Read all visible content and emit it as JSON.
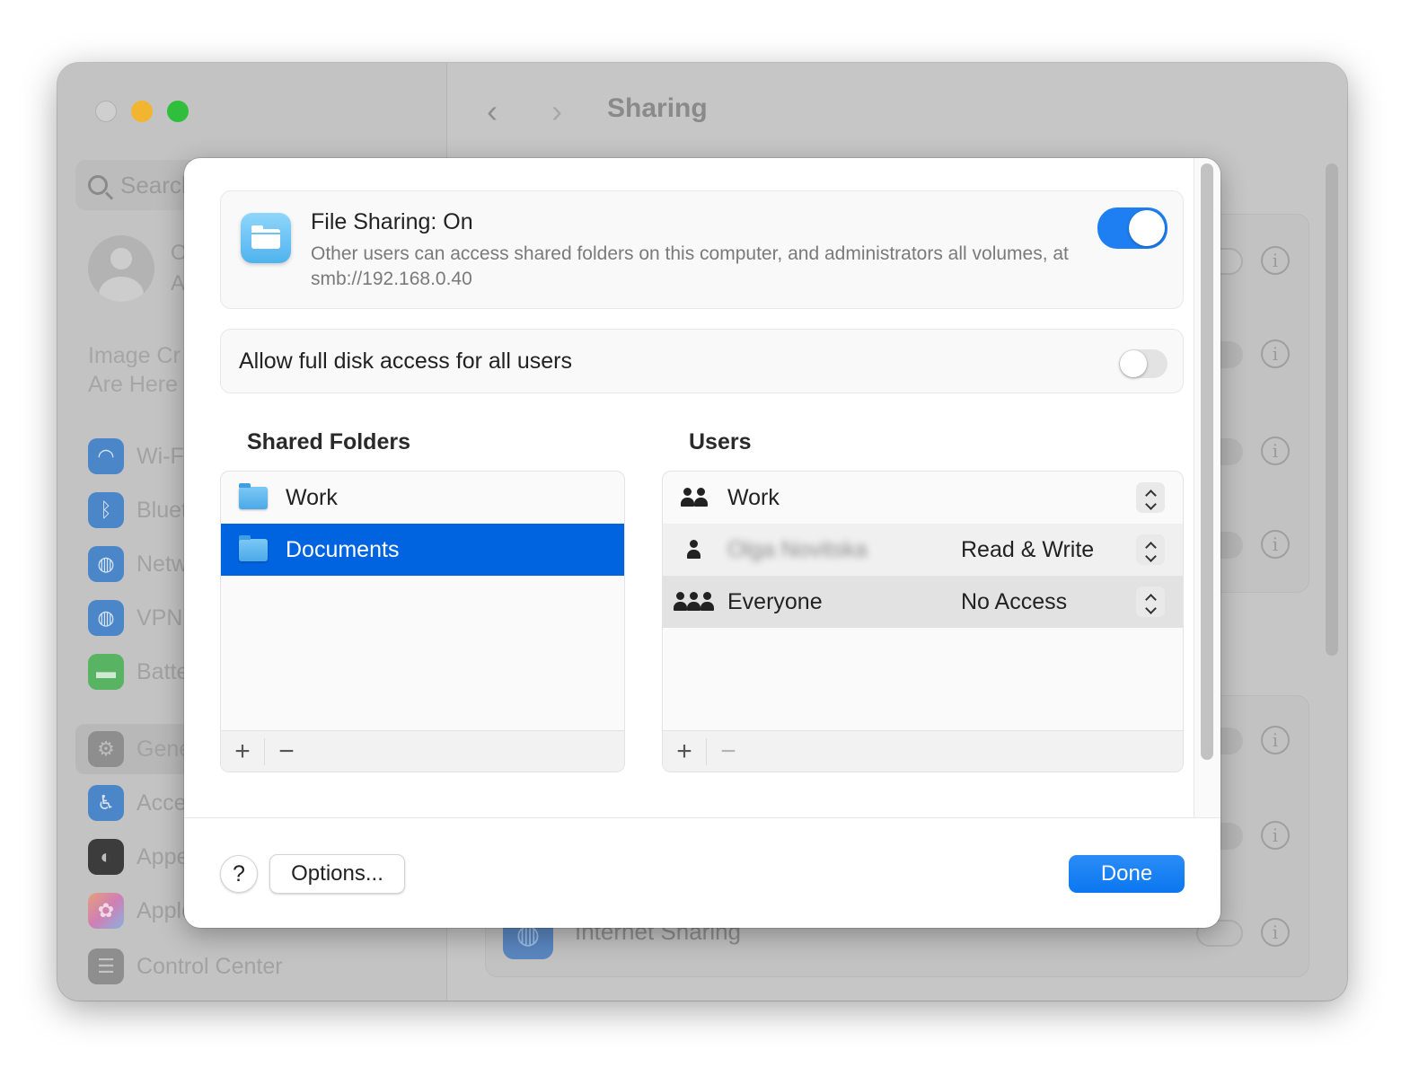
{
  "window": {
    "title": "Sharing",
    "traffic_lights": [
      "close",
      "minimize",
      "zoom"
    ]
  },
  "sidebar": {
    "search_placeholder": "Search",
    "account_line1": "O",
    "account_line2": "A",
    "promo_line1": "Image Cr",
    "promo_line2": "Are Here",
    "items": [
      {
        "label": "Wi-Fi",
        "icon": "wifi-icon",
        "color": "#4a86c8"
      },
      {
        "label": "Bluetooth",
        "icon": "bluetooth-icon",
        "color": "#4a86c8"
      },
      {
        "label": "Network",
        "icon": "globe-icon",
        "color": "#4a86c8"
      },
      {
        "label": "VPN",
        "icon": "vpn-globe-icon",
        "color": "#4a86c8"
      },
      {
        "label": "Battery",
        "icon": "battery-icon",
        "color": "#58b463"
      },
      {
        "label": "General",
        "icon": "gear-icon",
        "color": "#8e8e8e"
      },
      {
        "label": "Accessibility",
        "icon": "accessibility-icon",
        "color": "#4a86c8"
      },
      {
        "label": "Appearance",
        "icon": "appearance-icon",
        "color": "#3c3c3c"
      },
      {
        "label": "Apple Intelligence",
        "icon": "apple-intelligence-icon",
        "color": "#d98aa0"
      },
      {
        "label": "Control Center",
        "icon": "control-center-icon",
        "color": "#8e8e8e"
      }
    ],
    "selected": "General"
  },
  "background_content": {
    "visible_row_label": "Internet Sharing"
  },
  "sheet": {
    "file_sharing": {
      "title": "File Sharing: On",
      "description": "Other users can access shared folders on this computer, and administrators all volumes, at smb://192.168.0.40",
      "enabled": true
    },
    "full_disk_access": {
      "label": "Allow full disk access for all users",
      "enabled": false
    },
    "shared_folders": {
      "heading": "Shared Folders",
      "items": [
        {
          "name": "Work",
          "selected": false
        },
        {
          "name": "Documents",
          "selected": true
        }
      ],
      "add_label": "+",
      "remove_label": "−"
    },
    "users": {
      "heading": "Users",
      "items": [
        {
          "name": "Work",
          "icon": "group-icon",
          "permission": ""
        },
        {
          "name": "Olga Novitska",
          "icon": "user-icon",
          "permission": "Read & Write",
          "redacted": true
        },
        {
          "name": "Everyone",
          "icon": "everyone-icon",
          "permission": "No Access"
        }
      ],
      "add_label": "+",
      "remove_label": "−"
    },
    "buttons": {
      "help": "?",
      "options": "Options...",
      "done": "Done"
    }
  },
  "colors": {
    "accent": "#0064e0",
    "toggle_on": "#1d7ff2",
    "done_button": "#0b77f0"
  }
}
